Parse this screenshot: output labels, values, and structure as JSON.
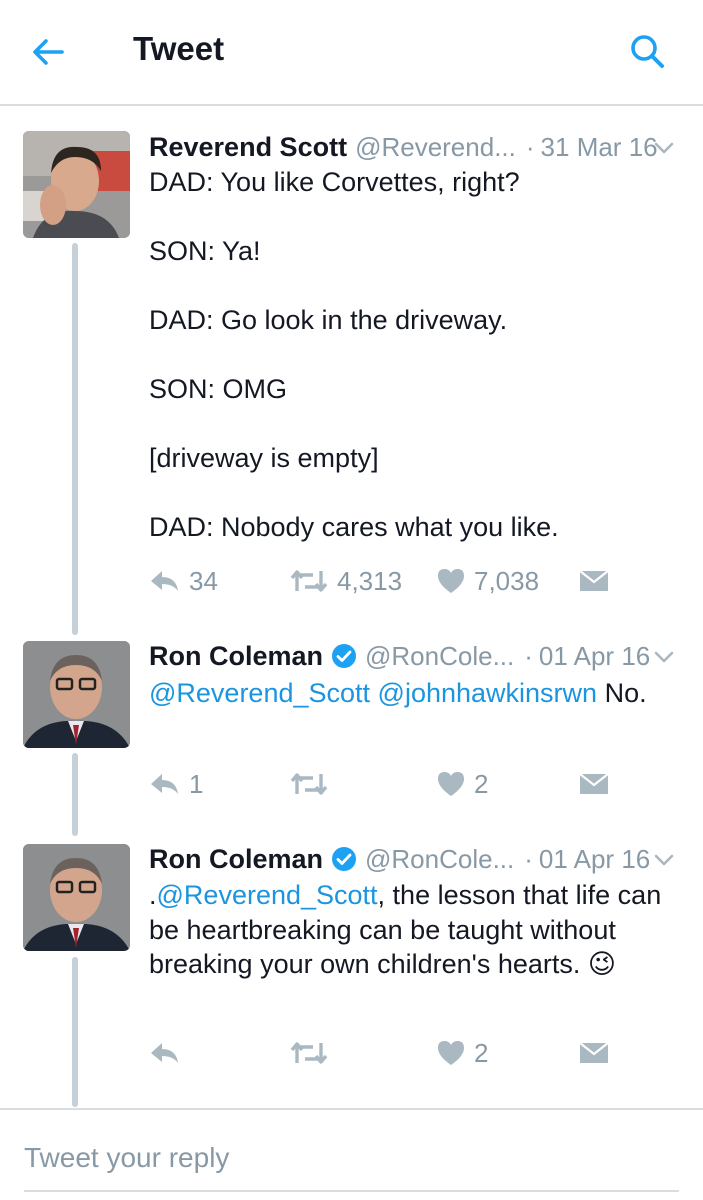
{
  "header": {
    "title": "Tweet",
    "back_icon": "arrow-left-icon",
    "search_icon": "search-icon",
    "accent": "#1da1f2"
  },
  "colors": {
    "mention": "#1b95e0",
    "muted": "#8899a6",
    "verified": "#1da1f2",
    "thread_line": "#c6d0d9"
  },
  "tweets": [
    {
      "name": "Reverend Scott",
      "handle": "@Reverend...",
      "date": "31 Mar 16",
      "verified": false,
      "lines": [
        "DAD: You like Corvettes, right?",
        "SON: Ya!",
        "DAD: Go look in the driveway.",
        "SON: OMG",
        "[driveway is empty]",
        "DAD: Nobody cares what you like."
      ],
      "stats": {
        "replies": "34",
        "retweets": "4,313",
        "likes": "7,038"
      }
    },
    {
      "name": "Ron Coleman",
      "handle": "@RonCole...",
      "date": "01 Apr 16",
      "verified": true,
      "mention1": "@Reverend_Scott",
      "mention2": "@johnhawkinsrwn",
      "text": " No.",
      "stats": {
        "replies": "1",
        "retweets": "",
        "likes": "2"
      }
    },
    {
      "name": "Ron Coleman",
      "handle": "@RonCole...",
      "date": "01 Apr 16",
      "verified": true,
      "prefix": ".",
      "mention1": "@Reverend_Scott",
      "text": ", the lesson that life can be heartbreaking can be taught without breaking your own children's hearts.",
      "emoji": "😉",
      "stats": {
        "replies": "",
        "retweets": "",
        "likes": "2"
      }
    }
  ],
  "reply": {
    "placeholder": "Tweet your reply"
  }
}
